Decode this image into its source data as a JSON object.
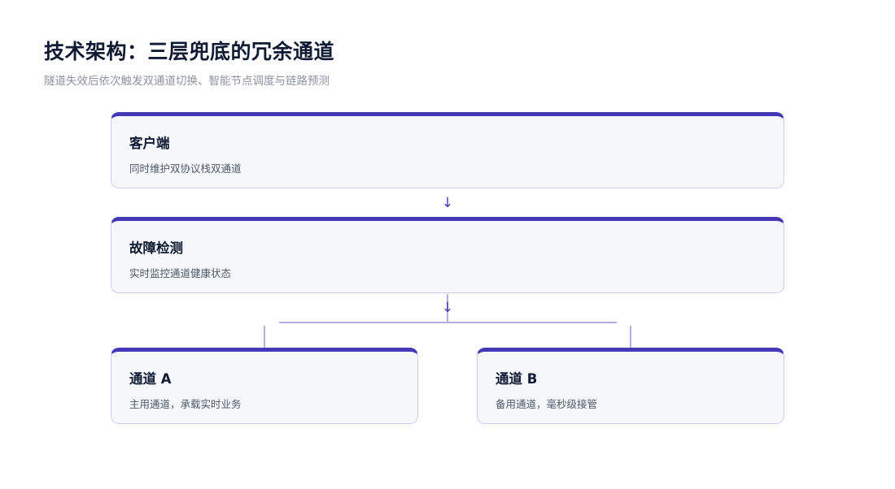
{
  "header": {
    "title": "技术架构：三层兜底的冗余通道",
    "subtitle": "隧道失效后依次触发双通道切换、智能节点调度与链路预测"
  },
  "nodes": {
    "client": {
      "title": "客户端",
      "desc": "同时维护双协议栈双通道"
    },
    "detect": {
      "title": "故障检测",
      "desc": "实时监控通道健康状态"
    },
    "channel_a": {
      "title": "通道 A",
      "desc": "主用通道，承载实时业务"
    },
    "channel_b": {
      "title": "通道 B",
      "desc": "备用通道，毫秒级接管"
    }
  },
  "connectors": {
    "arrow_symbol": "↓"
  },
  "colors": {
    "accent": "#4338b5",
    "box_bg": "#f5f8fb",
    "box_border": "#cfcbf0",
    "connector": "#b3aee3"
  }
}
